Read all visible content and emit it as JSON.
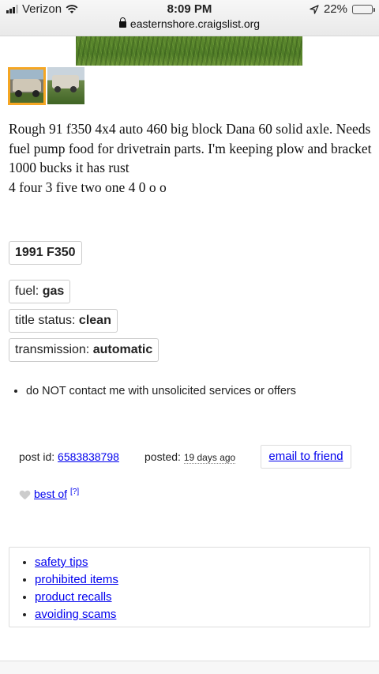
{
  "status_bar": {
    "carrier": "Verizon",
    "time": "8:09 PM",
    "battery_percent": "22%",
    "battery_level": 0.22,
    "url": "easternshore.craigslist.org",
    "signal_bars_active": 3
  },
  "gallery": {
    "thumbnails": [
      {
        "selected": true,
        "subject": "truck with plow"
      },
      {
        "selected": false,
        "subject": "truck on grass"
      }
    ]
  },
  "description": {
    "lines": [
      "Rough 91 f350 4x4 auto 460 big block Dana 60 solid axle. Needs fuel pump food for drivetrain parts. I'm keeping plow and bracket 1000 bucks it has rust",
      "4 four 3 five two one 4 0 o o"
    ]
  },
  "attributes": {
    "title": "1991 F350",
    "fuel_label": "fuel: ",
    "fuel_value": "gas",
    "title_status_label": "title status: ",
    "title_status_value": "clean",
    "transmission_label": "transmission: ",
    "transmission_value": "automatic"
  },
  "notices": [
    "do NOT contact me with unsolicited services or offers"
  ],
  "post_info": {
    "post_id_label": "post id: ",
    "post_id": "6583838798",
    "posted_label": "posted: ",
    "posted_ago": "19 days ago",
    "email_label": "email to friend"
  },
  "best_of": {
    "label": "best of",
    "help": "[?]"
  },
  "safety_links": [
    "safety tips",
    "prohibited items",
    "product recalls",
    "avoiding scams"
  ],
  "colors": {
    "link": "#0000ee",
    "selected_thumb_border": "#f5a623"
  },
  "icons": [
    "wifi-icon",
    "location-arrow-icon",
    "battery-icon",
    "lock-icon",
    "heart-icon"
  ]
}
